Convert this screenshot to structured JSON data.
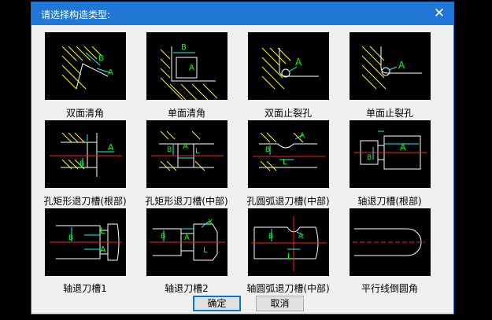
{
  "dialog": {
    "title": "请选择构造类型:",
    "close_glyph": "✕"
  },
  "items": [
    {
      "label": "双面清角",
      "icon": "double-face-corner-clearing-icon"
    },
    {
      "label": "单面清角",
      "icon": "single-face-corner-clearing-icon"
    },
    {
      "label": "双面止裂孔",
      "icon": "double-face-relief-hole-icon"
    },
    {
      "label": "单面止裂孔",
      "icon": "single-face-relief-hole-icon"
    },
    {
      "label": "孔矩形退刀槽(根部)",
      "icon": "hole-rect-undercut-root-icon"
    },
    {
      "label": "孔矩形退刀槽(中部)",
      "icon": "hole-rect-undercut-middle-icon"
    },
    {
      "label": "孔圆弧退刀槽(中部)",
      "icon": "hole-arc-undercut-middle-icon"
    },
    {
      "label": "轴退刀槽(根部)",
      "icon": "shaft-undercut-root-icon"
    },
    {
      "label": "轴退刀槽1",
      "icon": "shaft-undercut-1-icon"
    },
    {
      "label": "轴退刀槽2",
      "icon": "shaft-undercut-2-icon"
    },
    {
      "label": "轴圆弧退刀槽(中部)",
      "icon": "shaft-arc-undercut-middle-icon"
    },
    {
      "label": "平行线倒圆角",
      "icon": "parallel-line-fillet-icon"
    }
  ],
  "dim_labels": {
    "a": "A",
    "b": "B",
    "l": "L",
    "x": "X"
  },
  "colors": {
    "yellow": "#ffff00",
    "green": "#00ff00",
    "cyan": "#00ffff",
    "red": "#ff2020",
    "white": "#ffffff",
    "title_bar": "#1f78d6"
  },
  "buttons": {
    "ok": "确定",
    "cancel": "取消"
  }
}
